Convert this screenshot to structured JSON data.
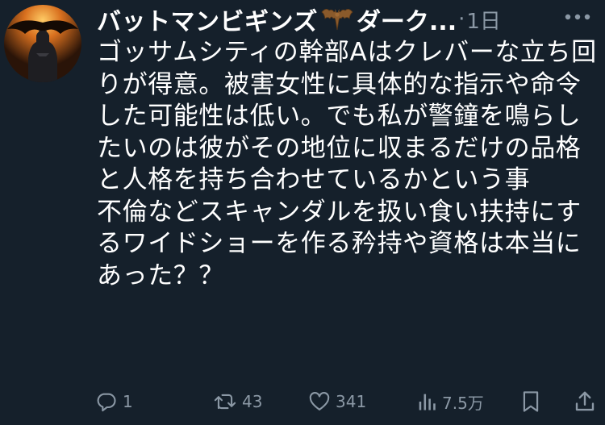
{
  "tweet": {
    "display_name": "バットマンビギンズ",
    "name_suffix": "ダーク...",
    "time": "1日",
    "separator": "·",
    "avatar_icon": "batman-avatar",
    "badge_icon": "bat-emoji-icon",
    "text": "ゴッサムシティの幹部Aはクレバーな立ち回りが得意。被害女性に具体的な指示や命令した可能性は低い。でも私が警鐘を鳴らしたいのは彼がその地位に収まるだけの品格と人格を持ち合わせているかという事\n不倫などスキャンダルを扱い食い扶持にするワイドショーを作る矜持や資格は本当にあった？？"
  },
  "actions": {
    "reply_count": "1",
    "retweet_count": "43",
    "like_count": "341",
    "views_count": "7.5万"
  },
  "colors": {
    "background": "#15202b",
    "text": "#ffffff",
    "secondary": "#8b98a5"
  }
}
